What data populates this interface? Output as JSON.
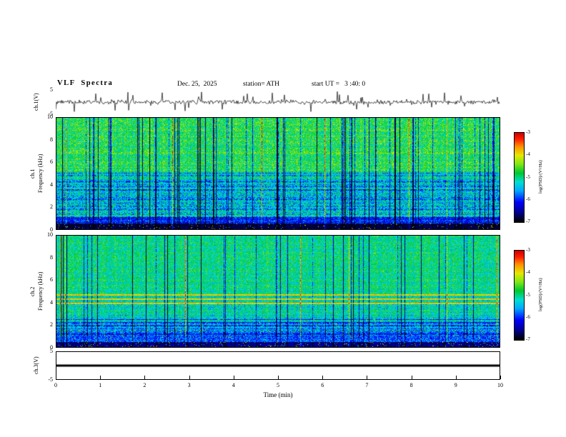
{
  "header": {
    "title": "VLF  Spectra",
    "date": "Dec. 25,  2025",
    "station": "station= ATH",
    "start_ut": "start UT =   3 :40: 0"
  },
  "xaxis": {
    "label": "Time  (min)",
    "ticks": [
      "0",
      "1",
      "2",
      "3",
      "4",
      "5",
      "6",
      "7",
      "8",
      "9",
      "10"
    ],
    "range": [
      0,
      10
    ]
  },
  "panels": {
    "ch1wave": {
      "ylabel": "ch.1(V)",
      "yticks": [
        "5",
        "-5"
      ],
      "ylim": [
        -5,
        5
      ]
    },
    "ch1spec": {
      "channel": "ch.1",
      "ylabel": "Frequency (kHz)",
      "yticks": [
        "10",
        "8",
        "6",
        "4",
        "2",
        "0"
      ],
      "ylim": [
        0,
        10
      ]
    },
    "ch2spec": {
      "channel": "ch.2",
      "ylabel": "Frequency (kHz)",
      "yticks": [
        "10",
        "8",
        "6",
        "4",
        "2",
        "0"
      ],
      "ylim": [
        0,
        10
      ]
    },
    "ch3wave": {
      "ylabel": "ch.3(V)",
      "yticks": [
        "5",
        "-5"
      ],
      "ylim": [
        -5,
        5
      ]
    }
  },
  "colorbar": {
    "label": "log(PSD)/(V²/Hz)",
    "ticks": [
      "-3",
      "-4",
      "-5",
      "-6",
      "-7"
    ],
    "range": [
      -3,
      -7
    ]
  },
  "colors": {
    "trace": "#000000",
    "frame": "#000000",
    "background": "#ffffff"
  },
  "chart_data": [
    {
      "type": "line",
      "panel": "ch1-voltage",
      "ylabel": "ch.1(V)",
      "xlabel": "Time (min)",
      "xlim": [
        0,
        10
      ],
      "ylim": [
        -5,
        5
      ],
      "yticks": [
        5,
        -5
      ],
      "line_color": "#000000",
      "series": [
        {
          "name": "ch.1 voltage",
          "summary": "continuous broadband noise centred on 0 V, envelope about ±1 V, with dense impulsive spikes reaching roughly ±3.5 V throughout the 10-minute record"
        }
      ]
    },
    {
      "type": "heatmap",
      "panel": "ch1-spectrogram",
      "ylabel": "ch.1 Frequency (kHz)",
      "xlabel": "Time (min)",
      "xlim": [
        0,
        10
      ],
      "ylim": [
        0,
        10
      ],
      "value_label": "log(PSD)/(V²/Hz)",
      "value_range": [
        -7,
        -3
      ],
      "colormap_stops": [
        [
          0,
          "#000000"
        ],
        [
          0.1,
          "#00008b"
        ],
        [
          0.22,
          "#0000ff"
        ],
        [
          0.35,
          "#00aaff"
        ],
        [
          0.45,
          "#00e0d0"
        ],
        [
          0.55,
          "#00c830"
        ],
        [
          0.65,
          "#7fe817"
        ],
        [
          0.75,
          "#e8e800"
        ],
        [
          0.85,
          "#ff9000"
        ],
        [
          0.93,
          "#ff2000"
        ],
        [
          1,
          "#d00000"
        ]
      ],
      "features": [
        "mid-to-high power (green/yellow, about -4.5 to -4) above ~5 kHz",
        "lower-power blue band with horizontal interference striations between ~1.5 and 5 kHz",
        "dense dark-blue vertical dropout columns crossing all frequencies (impulsive sferics)",
        "occasional orange/red high-power vertical streaks",
        "near-black lowest band below ~1 kHz (about -7)"
      ]
    },
    {
      "type": "heatmap",
      "panel": "ch2-spectrogram",
      "ylabel": "ch.2 Frequency (kHz)",
      "xlabel": "Time (min)",
      "xlim": [
        0,
        10
      ],
      "ylim": [
        0,
        10
      ],
      "value_label": "log(PSD)/(V²/Hz)",
      "value_range": [
        -7,
        -3
      ],
      "colormap_stops": [
        [
          0,
          "#000000"
        ],
        [
          0.1,
          "#00008b"
        ],
        [
          0.22,
          "#0000ff"
        ],
        [
          0.35,
          "#00aaff"
        ],
        [
          0.45,
          "#00e0d0"
        ],
        [
          0.55,
          "#00c830"
        ],
        [
          0.65,
          "#7fe817"
        ],
        [
          0.75,
          "#e8e800"
        ],
        [
          0.85,
          "#ff9000"
        ],
        [
          0.93,
          "#ff2000"
        ],
        [
          1,
          "#d00000"
        ]
      ],
      "features": [
        "fairly uniform cyan-green power (about -4.8) above ~4.5 kHz with scattered dark vertical impulse columns",
        "thin orange/red horizontal interference lines near 4.0-4.7 kHz",
        "grey/black horizontal banding mixed with colourful speckle between ~1 and 2.6 kHz",
        "near-black band below ~1 kHz with green speckle"
      ]
    },
    {
      "type": "line",
      "panel": "ch3-voltage",
      "ylabel": "ch.3(V)",
      "xlabel": "Time (min)",
      "xlim": [
        0,
        10
      ],
      "ylim": [
        -5,
        5
      ],
      "yticks": [
        5,
        -5
      ],
      "line_color": "#000000",
      "series": [
        {
          "name": "ch.3 voltage",
          "summary": "constant flat 0 V thick black line for the entire record"
        }
      ]
    }
  ]
}
